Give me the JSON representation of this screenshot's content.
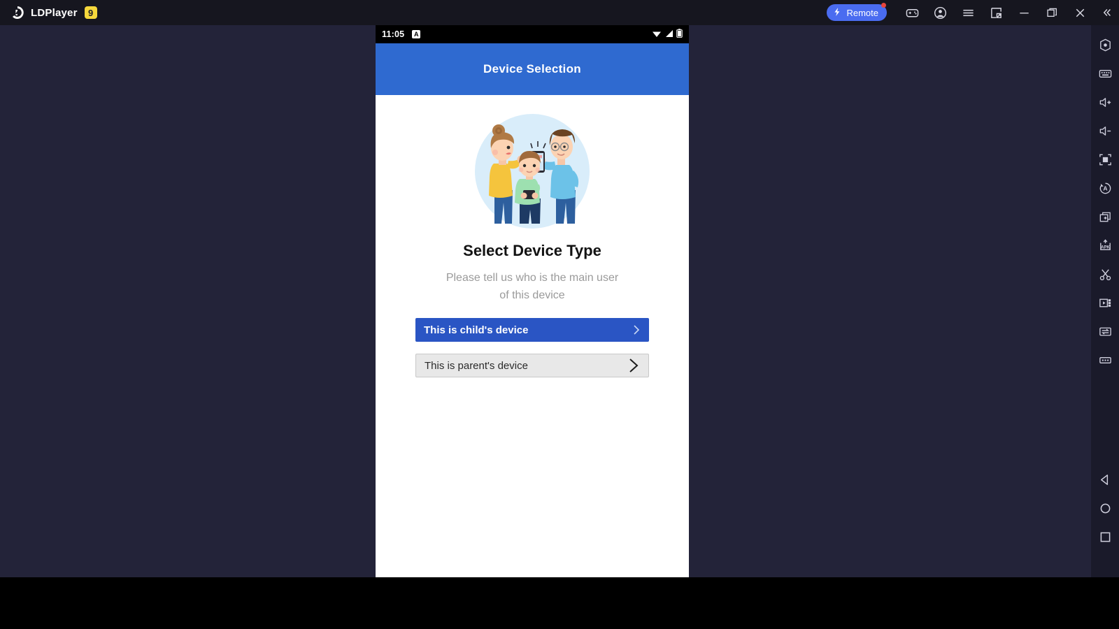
{
  "titlebar": {
    "brand_name": "LDPlayer",
    "brand_badge": "9",
    "brand_logo_icon": "ldplayer-logo-icon",
    "remote": {
      "label": "Remote",
      "icon": "lightning-bolt-icon",
      "has_notification_dot": true,
      "color": "#4a6cf0"
    },
    "icons": [
      {
        "name": "gamepad-icon",
        "glyph": "gamepad"
      },
      {
        "name": "account-icon",
        "glyph": "account"
      },
      {
        "name": "menu-icon",
        "glyph": "hamburger"
      },
      {
        "name": "expand-window-icon",
        "glyph": "expand"
      },
      {
        "name": "minimize-icon",
        "glyph": "minimize"
      },
      {
        "name": "maximize-icon",
        "glyph": "maximize"
      },
      {
        "name": "close-icon",
        "glyph": "close"
      },
      {
        "name": "collapse-sidebar-icon",
        "glyph": "double-chevron-left"
      }
    ]
  },
  "sidebar": {
    "tools": [
      {
        "name": "settings-icon",
        "glyph": "hexagon-dot"
      },
      {
        "name": "keyboard-icon",
        "glyph": "keyboard"
      },
      {
        "name": "volume-up-icon",
        "glyph": "volume-plus"
      },
      {
        "name": "volume-down-icon",
        "glyph": "volume-minus"
      },
      {
        "name": "fullscreen-icon",
        "glyph": "fullscreen"
      },
      {
        "name": "auto-rotate-icon",
        "glyph": "rotate-a"
      },
      {
        "name": "multi-instance-icon",
        "glyph": "windows-plus"
      },
      {
        "name": "install-apk-icon",
        "glyph": "apk",
        "label": "APK"
      },
      {
        "name": "screenshot-icon",
        "glyph": "scissors"
      },
      {
        "name": "screen-record-icon",
        "glyph": "video"
      },
      {
        "name": "file-transfer-icon",
        "glyph": "transfer-arrows"
      },
      {
        "name": "more-options-icon",
        "glyph": "ellipsis"
      }
    ],
    "nav": [
      {
        "name": "android-back-button",
        "glyph": "triangle-left"
      },
      {
        "name": "android-home-button",
        "glyph": "circle"
      },
      {
        "name": "android-recents-button",
        "glyph": "square"
      }
    ]
  },
  "phone": {
    "statusbar": {
      "time": "11:05",
      "app_icon": "app-notification-icon",
      "icons": [
        {
          "name": "wifi-icon"
        },
        {
          "name": "cellular-signal-icon"
        },
        {
          "name": "battery-icon"
        }
      ]
    },
    "appbar": {
      "title": "Device Selection",
      "color": "#2f6ad0"
    },
    "screen": {
      "illustration_name": "family-using-phone-illustration",
      "heading": "Select Device Type",
      "subtitle": "Please tell us who is the main user of this device",
      "buttons": [
        {
          "name": "child-device-button",
          "label": "This is child's device",
          "style": "primary",
          "color": "#2a55c4",
          "chevron": "chevron-right-icon"
        },
        {
          "name": "parent-device-button",
          "label": "This is parent's device",
          "style": "secondary",
          "color": "#e8e8e8",
          "chevron": "chevron-right-icon"
        }
      ]
    }
  }
}
